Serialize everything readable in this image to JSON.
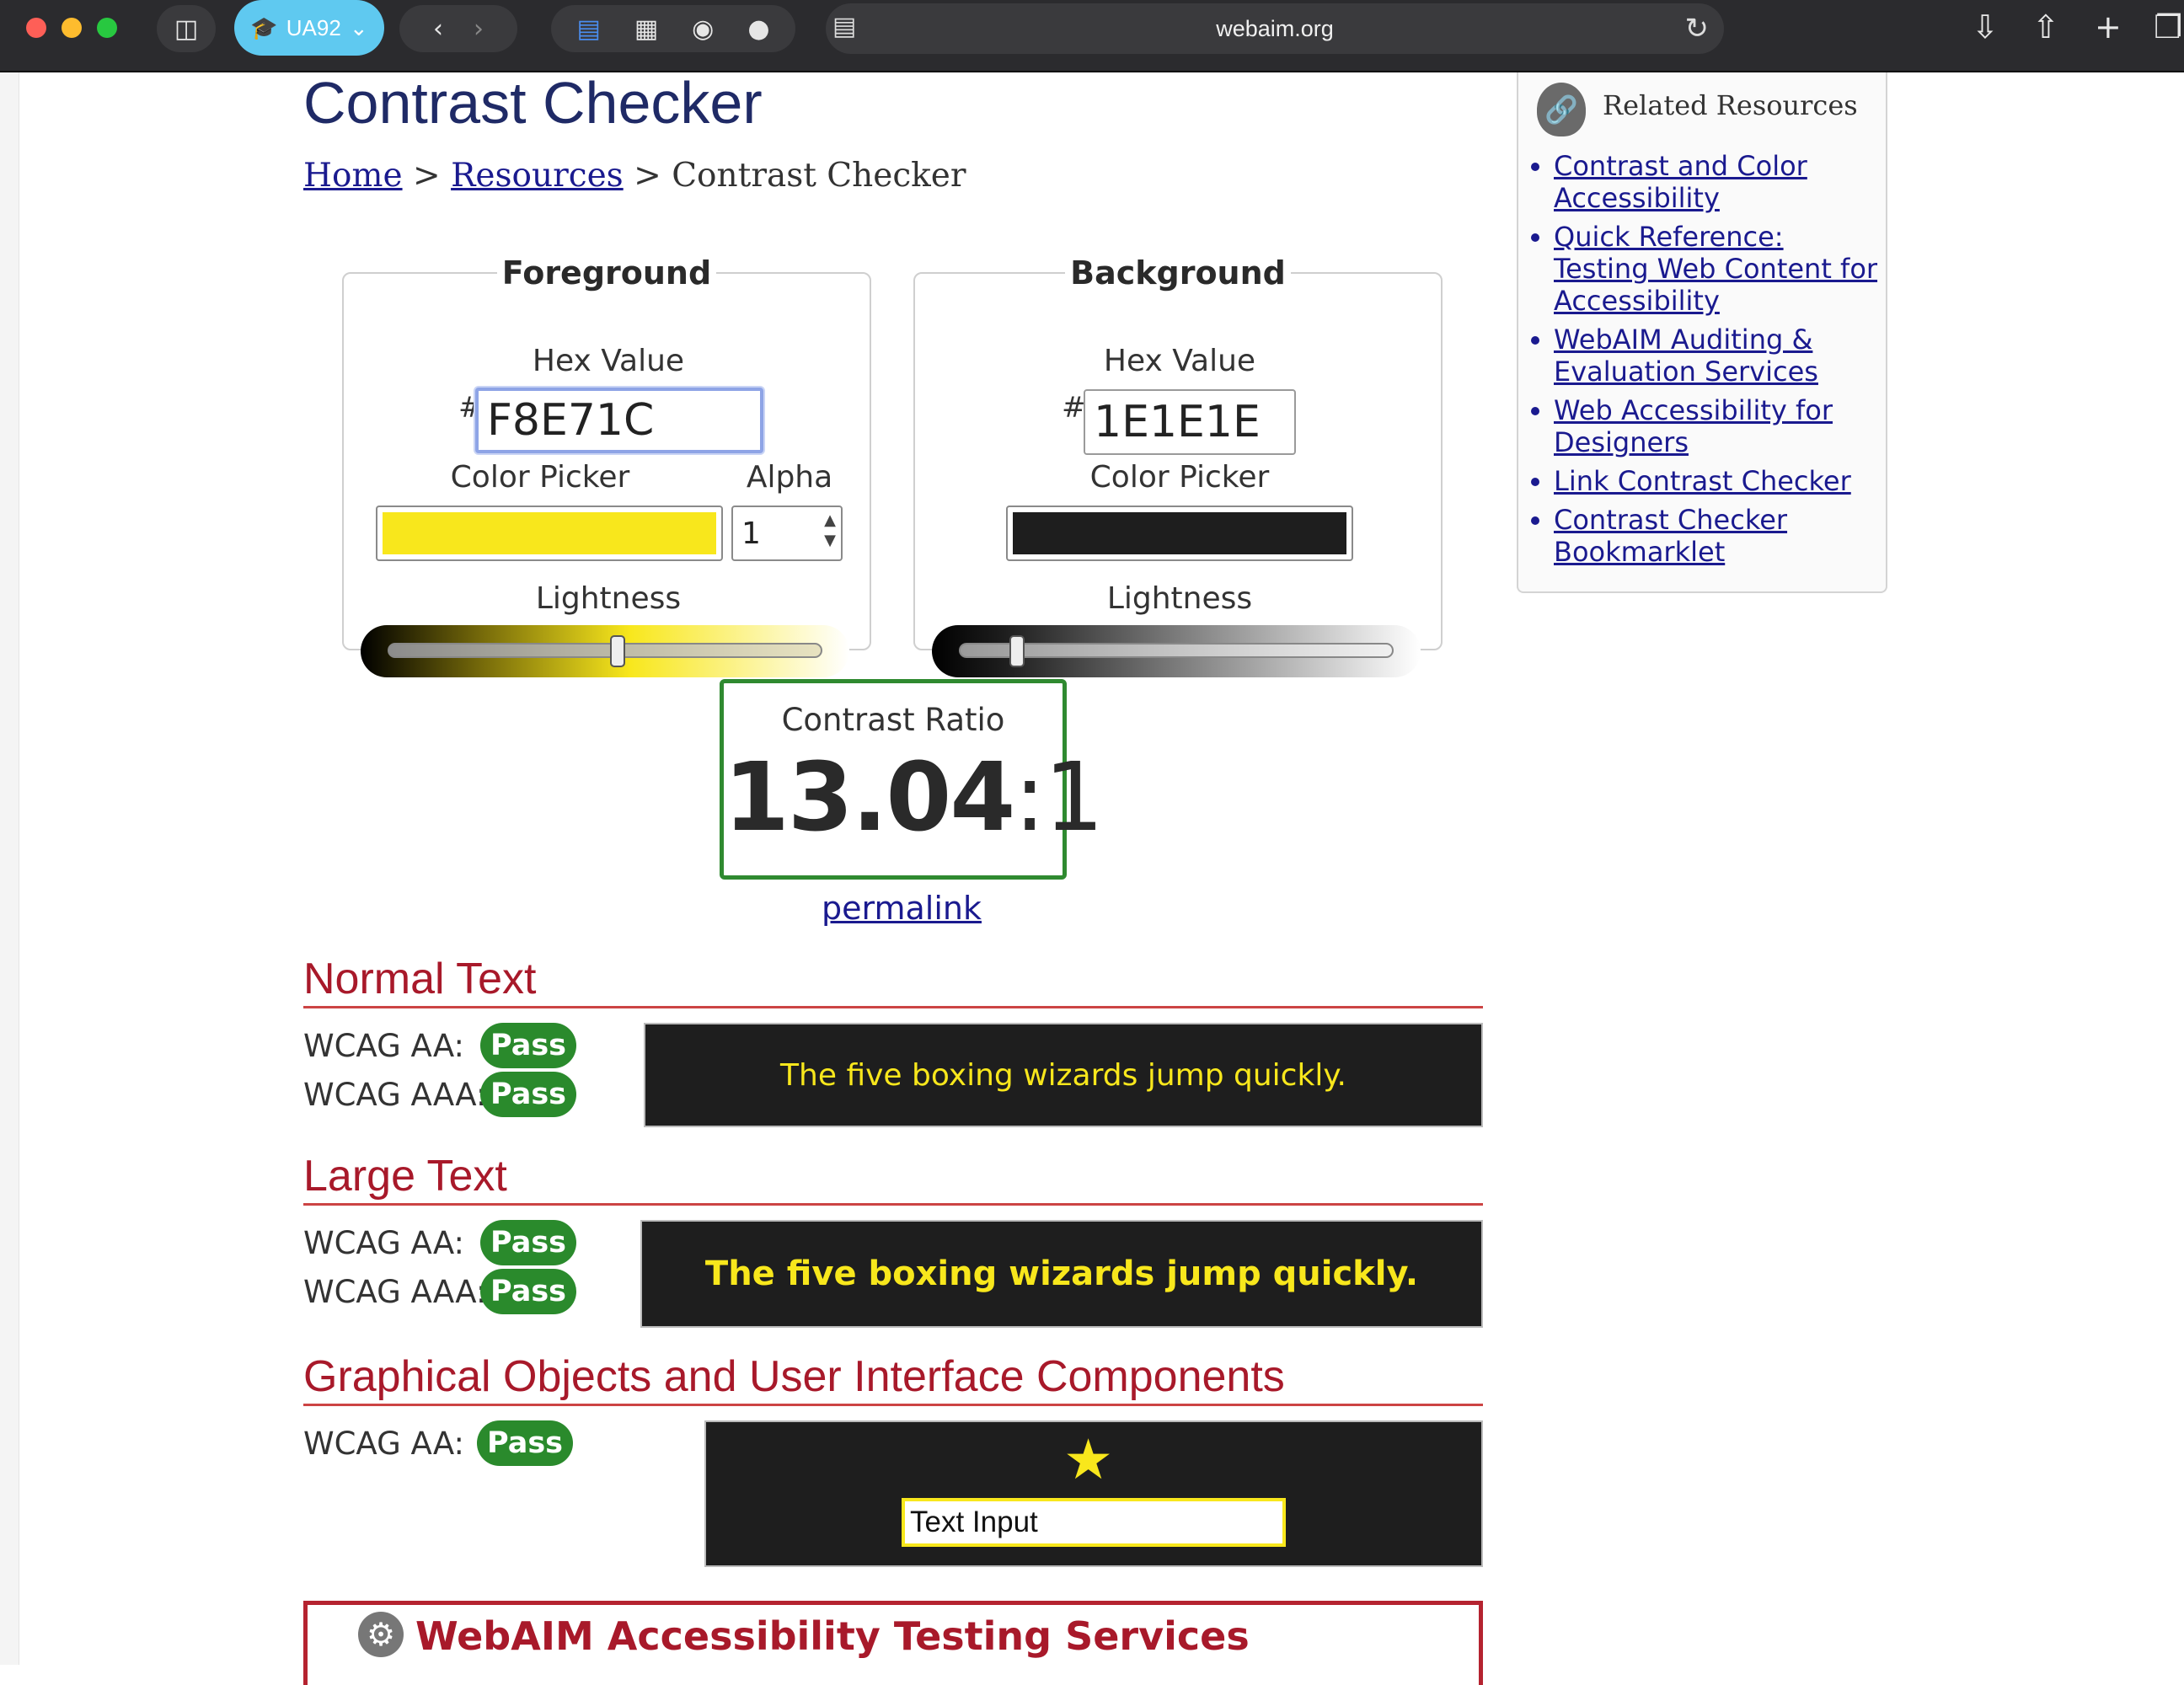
{
  "browser": {
    "profile_label": "UA92",
    "url": "webaim.org"
  },
  "page": {
    "title": "Contrast Checker",
    "breadcrumb": {
      "home": "Home",
      "sep": ">",
      "resources": "Resources",
      "current": "Contrast Checker"
    }
  },
  "foreground": {
    "legend": "Foreground",
    "hex_label": "Hex Value",
    "hash": "#",
    "hex_value": "F8E71C",
    "picker_label": "Color Picker",
    "color": "#F8E71C",
    "alpha_label": "Alpha",
    "alpha_value": "1",
    "lightness_label": "Lightness",
    "lightness_level": 0.53
  },
  "background": {
    "legend": "Background",
    "hex_label": "Hex Value",
    "hash": "#",
    "hex_value": "1E1E1E",
    "picker_label": "Color Picker",
    "color": "#1E1E1E",
    "lightness_label": "Lightness",
    "lightness_level": 0.12
  },
  "result": {
    "caption": "Contrast Ratio",
    "ratio_main": "13.04",
    "ratio_suffix": ":1",
    "permalink": "permalink"
  },
  "sections": {
    "normal": {
      "heading": "Normal Text",
      "aa_label": "WCAG AA:",
      "aa_result": "Pass",
      "aaa_label": "WCAG AAA:",
      "aaa_result": "Pass",
      "sample": "The five boxing wizards jump quickly."
    },
    "large": {
      "heading": "Large Text",
      "aa_label": "WCAG AA:",
      "aa_result": "Pass",
      "aaa_label": "WCAG AAA:",
      "aaa_result": "Pass",
      "sample": "The five boxing wizards jump quickly."
    },
    "graphical": {
      "heading": "Graphical Objects and User Interface Components",
      "aa_label": "WCAG AA:",
      "aa_result": "Pass",
      "input_value": "Text Input"
    },
    "services": {
      "heading": "WebAIM Accessibility Testing Services"
    }
  },
  "sidebar": {
    "heading": "Related Resources",
    "links": [
      "Contrast and Color Accessibility",
      "Quick Reference: Testing Web Content for Accessibility",
      "WebAIM Auditing & Evaluation Services",
      "Web Accessibility for Designers",
      "Link Contrast Checker",
      "Contrast Checker Bookmarklet"
    ]
  },
  "colors": {
    "pass_green": "#2A8A2C",
    "heading_red": "#A8192A",
    "title_navy": "#1F2A66",
    "link_blue": "#1A1A8F",
    "ratio_border": "#2F8A30"
  }
}
